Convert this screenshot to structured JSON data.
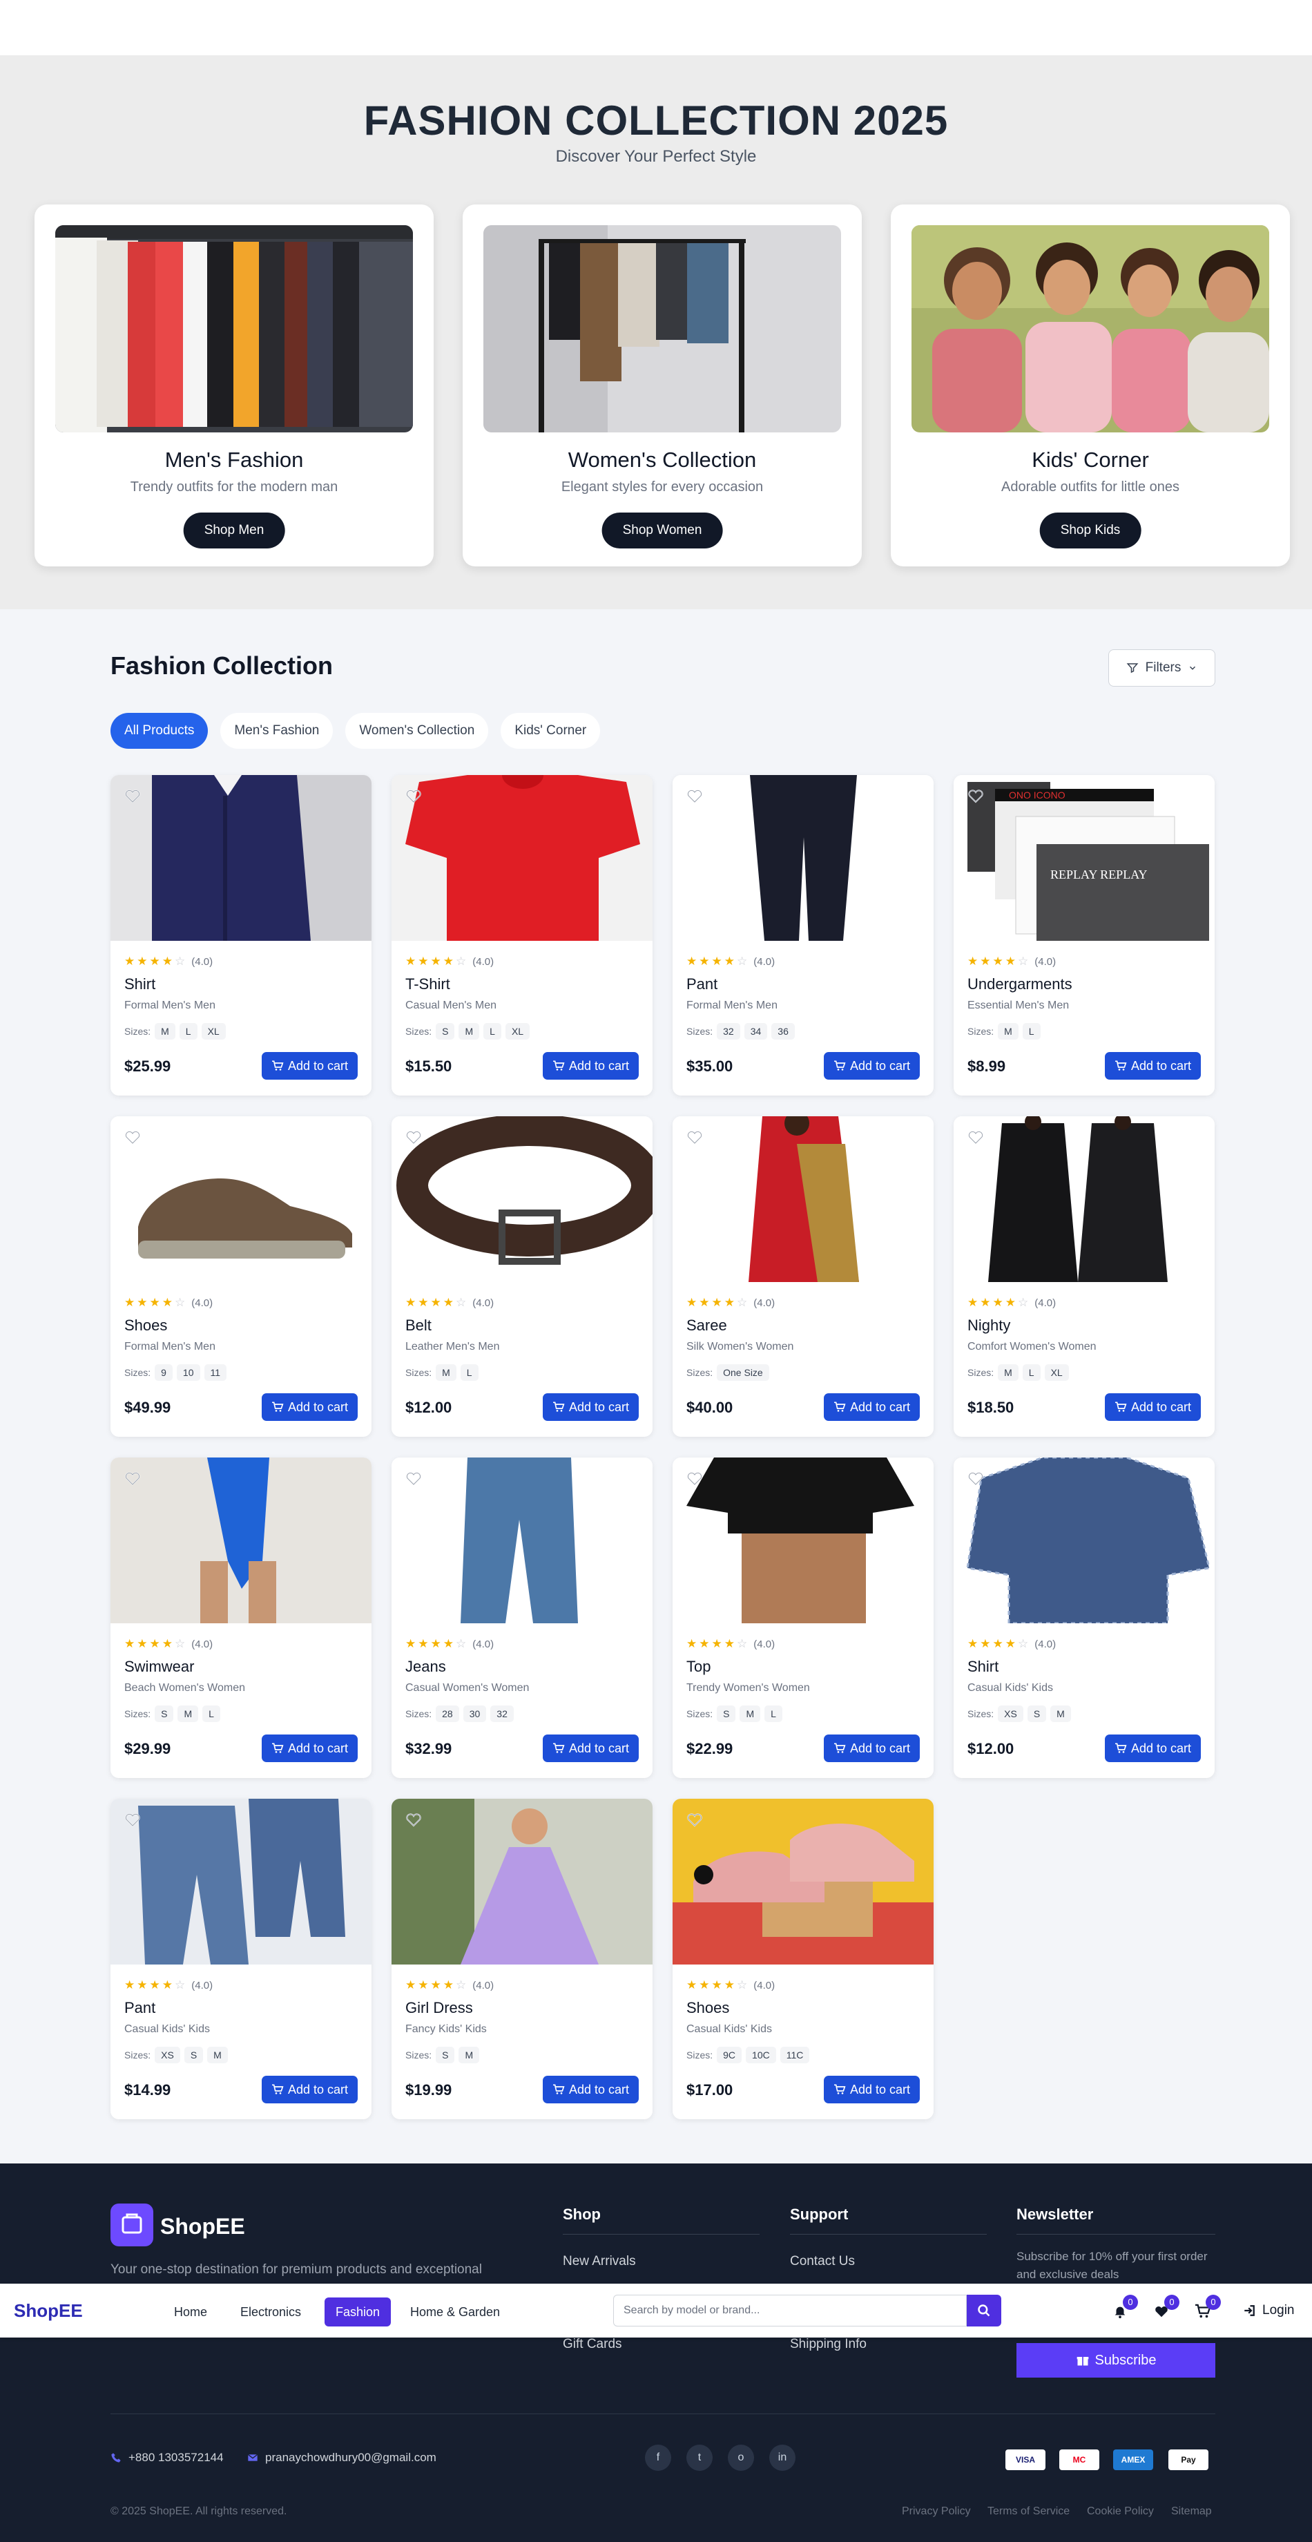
{
  "hero": {
    "title": "FASHION COLLECTION 2025",
    "subtitle": "Discover Your Perfect Style",
    "cards": [
      {
        "title": "Men's Fashion",
        "desc": "Trendy outfits for the modern man",
        "button": "Shop Men"
      },
      {
        "title": "Women's Collection",
        "desc": "Elegant styles for every occasion",
        "button": "Shop Women"
      },
      {
        "title": "Kids' Corner",
        "desc": "Adorable outfits for little ones",
        "button": "Shop Kids"
      }
    ]
  },
  "collection": {
    "title": "Fashion Collection",
    "filters_label": "Filters",
    "tabs": [
      "All Products",
      "Men's Fashion",
      "Women's Collection",
      "Kids' Corner"
    ],
    "active_tab": "All Products",
    "sizes_label": "Sizes:",
    "add_to_cart": "Add to cart",
    "products": [
      {
        "name": "Shirt",
        "cat": "Formal Men's Men",
        "price": "$25.99",
        "rating": "(4.0)",
        "stars": 4,
        "sizes": [
          "M",
          "L",
          "XL"
        ],
        "image": "checked-navy-shirt"
      },
      {
        "name": "T-Shirt",
        "cat": "Casual Men's Men",
        "price": "$15.50",
        "rating": "(4.0)",
        "stars": 4,
        "sizes": [
          "S",
          "M",
          "L",
          "XL"
        ],
        "image": "red-tshirt"
      },
      {
        "name": "Pant",
        "cat": "Formal Men's Men",
        "price": "$35.00",
        "rating": "(4.0)",
        "stars": 4,
        "sizes": [
          "32",
          "34",
          "36"
        ],
        "image": "navy-trousers"
      },
      {
        "name": "Undergarments",
        "cat": "Essential Men's Men",
        "price": "$8.99",
        "rating": "(4.0)",
        "stars": 4,
        "sizes": [
          "M",
          "L"
        ],
        "image": "boxer-briefs"
      },
      {
        "name": "Shoes",
        "cat": "Formal Men's Men",
        "price": "$49.99",
        "rating": "(4.0)",
        "stars": 4,
        "sizes": [
          "9",
          "10",
          "11"
        ],
        "image": "brown-shoe"
      },
      {
        "name": "Belt",
        "cat": "Leather Men's Men",
        "price": "$12.00",
        "rating": "(4.0)",
        "stars": 4,
        "sizes": [
          "M",
          "L"
        ],
        "image": "leather-belt"
      },
      {
        "name": "Saree",
        "cat": "Silk Women's Women",
        "price": "$40.00",
        "rating": "(4.0)",
        "stars": 4,
        "sizes": [
          "One Size"
        ],
        "image": "red-saree"
      },
      {
        "name": "Nighty",
        "cat": "Comfort Women's Women",
        "price": "$18.50",
        "rating": "(4.0)",
        "stars": 4,
        "sizes": [
          "M",
          "L",
          "XL"
        ],
        "image": "black-nighty"
      },
      {
        "name": "Swimwear",
        "cat": "Beach Women's Women",
        "price": "$29.99",
        "rating": "(4.0)",
        "stars": 4,
        "sizes": [
          "S",
          "M",
          "L"
        ],
        "image": "blue-swimsuit"
      },
      {
        "name": "Jeans",
        "cat": "Casual Women's Women",
        "price": "$32.99",
        "rating": "(4.0)",
        "stars": 4,
        "sizes": [
          "28",
          "30",
          "32"
        ],
        "image": "blue-jeans"
      },
      {
        "name": "Top",
        "cat": "Trendy Women's Women",
        "price": "$22.99",
        "rating": "(4.0)",
        "stars": 4,
        "sizes": [
          "S",
          "M",
          "L"
        ],
        "image": "black-crop-top"
      },
      {
        "name": "Shirt",
        "cat": "Casual Kids' Kids",
        "price": "$12.00",
        "rating": "(4.0)",
        "stars": 4,
        "sizes": [
          "XS",
          "S",
          "M"
        ],
        "image": "kids-check-shirt"
      },
      {
        "name": "Pant",
        "cat": "Casual Kids' Kids",
        "price": "$14.99",
        "rating": "(4.0)",
        "stars": 4,
        "sizes": [
          "XS",
          "S",
          "M"
        ],
        "image": "kids-denim-pants"
      },
      {
        "name": "Girl Dress",
        "cat": "Fancy Kids' Kids",
        "price": "$19.99",
        "rating": "(4.0)",
        "stars": 4,
        "sizes": [
          "S",
          "M"
        ],
        "image": "purple-dress"
      },
      {
        "name": "Shoes",
        "cat": "Casual Kids' Kids",
        "price": "$17.00",
        "rating": "(4.0)",
        "stars": 4,
        "sizes": [
          "9C",
          "10C",
          "11C"
        ],
        "image": "pink-sneakers"
      }
    ]
  },
  "footer": {
    "brand": "ShopEE",
    "description": "Your one-stop destination for premium products and exceptional",
    "shop_heading": "Shop",
    "shop_links": [
      "New Arrivals",
      "Gift Cards"
    ],
    "support_heading": "Support",
    "support_links": [
      "Contact Us",
      "Shipping Info"
    ],
    "newsletter_heading": "Newsletter",
    "newsletter_text": "Subscribe for 10% off your first order and exclusive deals",
    "subscribe": "Subscribe",
    "phone": "+880 1303572144",
    "email": "pranaychowdhury00@gmail.com",
    "social": [
      "f",
      "t",
      "o",
      "in"
    ],
    "payments": [
      "VISA",
      "MC",
      "AMEX",
      "Pay"
    ],
    "copyright": "© 2025 ShopEE. All rights reserved.",
    "bottom_links": [
      "Privacy Policy",
      "Terms of Service",
      "Cookie Policy",
      "Sitemap"
    ]
  },
  "navbar": {
    "brand": "ShopEE",
    "links": [
      "Home",
      "Electronics",
      "Fashion",
      "Home & Garden"
    ],
    "active": "Fashion",
    "search_placeholder": "Search by model or brand...",
    "notif_count": "0",
    "wish_count": "0",
    "cart_count": "0",
    "login": "Login"
  },
  "colors": {
    "accent": "#1d4ed8",
    "brand": "#4f2fe0",
    "footer_bg": "#161e2e"
  }
}
